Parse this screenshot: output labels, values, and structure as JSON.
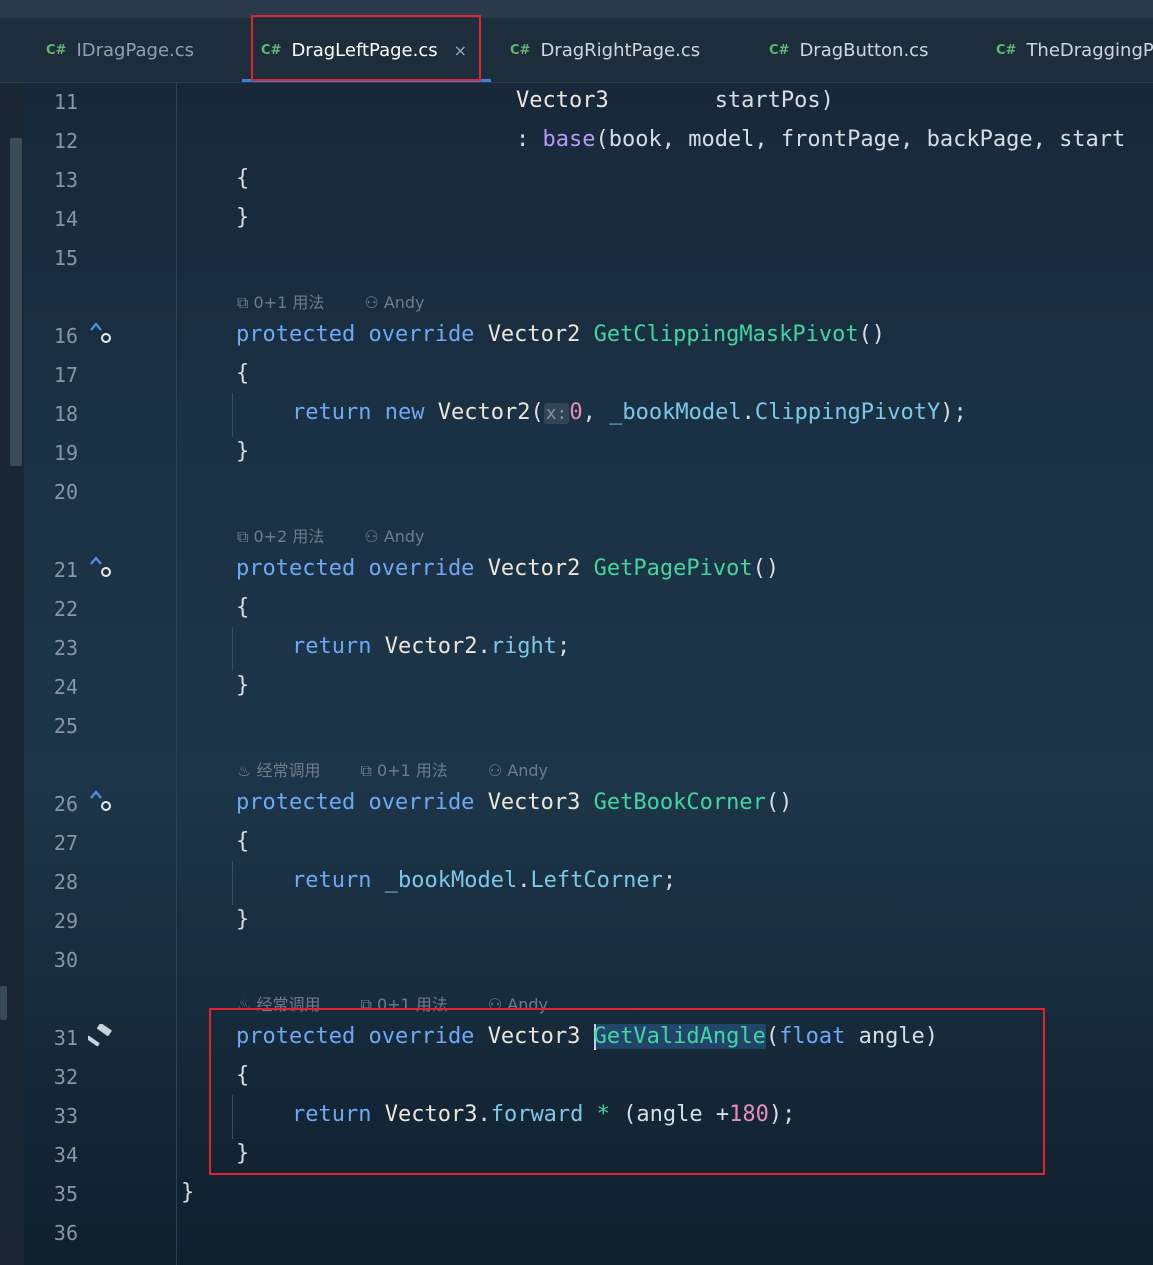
{
  "tabs": [
    {
      "lang": "C#",
      "label": "IDragPage.cs"
    },
    {
      "lang": "C#",
      "label": "DragLeftPage.cs",
      "close": "×"
    },
    {
      "lang": "C#",
      "label": "DragRightPage.cs"
    },
    {
      "lang": "C#",
      "label": "DragButton.cs"
    },
    {
      "lang": "C#",
      "label": "TheDraggingP"
    }
  ],
  "line_numbers": [
    "11",
    "12",
    "13",
    "14",
    "15",
    "16",
    "17",
    "18",
    "19",
    "20",
    "21",
    "22",
    "23",
    "24",
    "25",
    "26",
    "27",
    "28",
    "29",
    "30",
    "31",
    "32",
    "33",
    "34",
    "35",
    "36"
  ],
  "code": {
    "l11_type": "Vector3",
    "l11_param": "startPos)",
    "l12_colon": ": ",
    "l12_base": "base",
    "l12_args": "(book, model, frontPage, backPage, start",
    "open_brace": "{",
    "close_brace": "}",
    "kw_protected": "protected",
    "kw_override": "override",
    "kw_return": "return",
    "kw_new": "new",
    "kw_float": "float",
    "t_vector2": "Vector2",
    "t_vector3": "Vector3",
    "m1_name": "GetClippingMaskPivot",
    "m2_name": "GetPagePivot",
    "m3_name": "GetBookCorner",
    "m4_name": "GetValidAngle",
    "parens": "()",
    "l18_open": "(",
    "l18_hint": "x:",
    "l18_zero": "0",
    "l18_comma": ", ",
    "l18_field": "_bookModel",
    "l18_dot": ".",
    "l18_prop": "ClippingPivotY",
    "l18_end": ");",
    "l23_right": "right",
    "l23_end": ";",
    "l28_field": "_bookModel",
    "l28_prop": "LeftCorner",
    "l31_open": "(",
    "l31_param": " angle)",
    "l33_forward": "forward",
    "l33_star": " * ",
    "l33_angle": "(angle +",
    "l33_num": "180",
    "l33_end": ");"
  },
  "meta": {
    "m1_usage": "0+1 用法",
    "m2_usage": "0+2 用法",
    "m3_usage": "0+1 用法",
    "m4_usage": "0+1 用法",
    "frequent": "经常调用",
    "author": "Andy"
  },
  "icons": {
    "tab_lang": "csharp-icon",
    "override": "override-up-icon",
    "hammer": "hammer-icon",
    "usage": "usage-link-icon",
    "author": "person-icon",
    "frequent": "flame-icon"
  },
  "colors": {
    "keyword": "#6ea8f5",
    "type": "#ece6da",
    "method": "#3fd6a0",
    "number": "#e88fb8",
    "field": "#7dc7e8",
    "highlight_box": "#e0242d",
    "active_tab_underline": "#3d7fe0"
  }
}
